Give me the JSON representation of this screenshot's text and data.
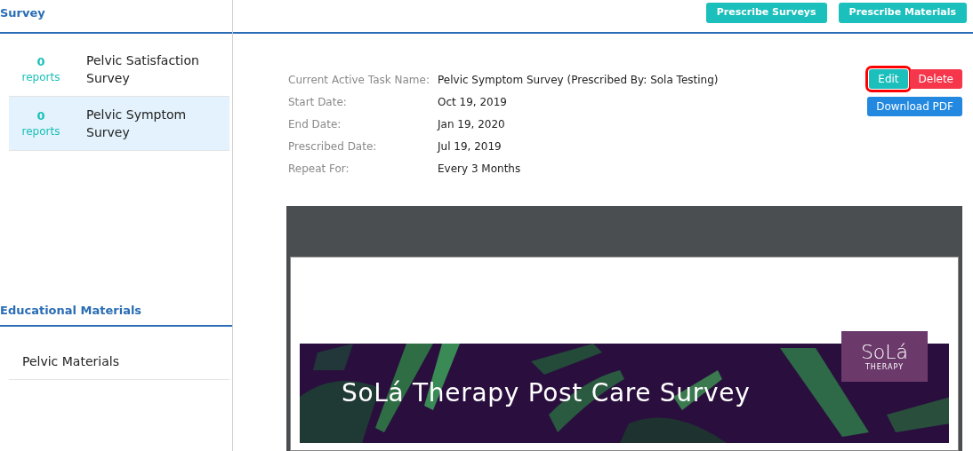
{
  "sidebar": {
    "survey_heading": "Survey",
    "surveys": [
      {
        "count": "0",
        "count_label": "reports",
        "name": "Pelvic Satisfaction Survey",
        "selected": false
      },
      {
        "count": "0",
        "count_label": "reports",
        "name": "Pelvic Symptom Survey",
        "selected": true
      }
    ],
    "materials_heading": "Educational Materials",
    "materials": [
      {
        "name": "Pelvic Materials",
        "selected": false
      }
    ]
  },
  "toolbar": {
    "buttons": [
      "Prescribe Surveys",
      "Prescribe Materials"
    ]
  },
  "details": [
    {
      "label": "Current Active Task Name:",
      "value": "Pelvic Symptom Survey (Prescribed By: Sola Testing)"
    },
    {
      "label": "Start Date:",
      "value": "Oct 19, 2019"
    },
    {
      "label": "End Date:",
      "value": "Jan 19, 2020"
    },
    {
      "label": "Prescribed Date:",
      "value": "Jul 19, 2019"
    },
    {
      "label": "Repeat For:",
      "value": "Every 3 Months"
    }
  ],
  "actions": [
    {
      "kind": "edit",
      "label": "Edit",
      "highlighted": true
    },
    {
      "kind": "delete",
      "label": "Delete",
      "highlighted": false
    },
    {
      "kind": "download",
      "label": "Download PDF",
      "highlighted": false
    }
  ],
  "preview": {
    "banner_title": "SoLá Therapy Post Care Survey",
    "logo": {
      "name": "SoLá",
      "tagline": "THERAPY"
    }
  }
}
